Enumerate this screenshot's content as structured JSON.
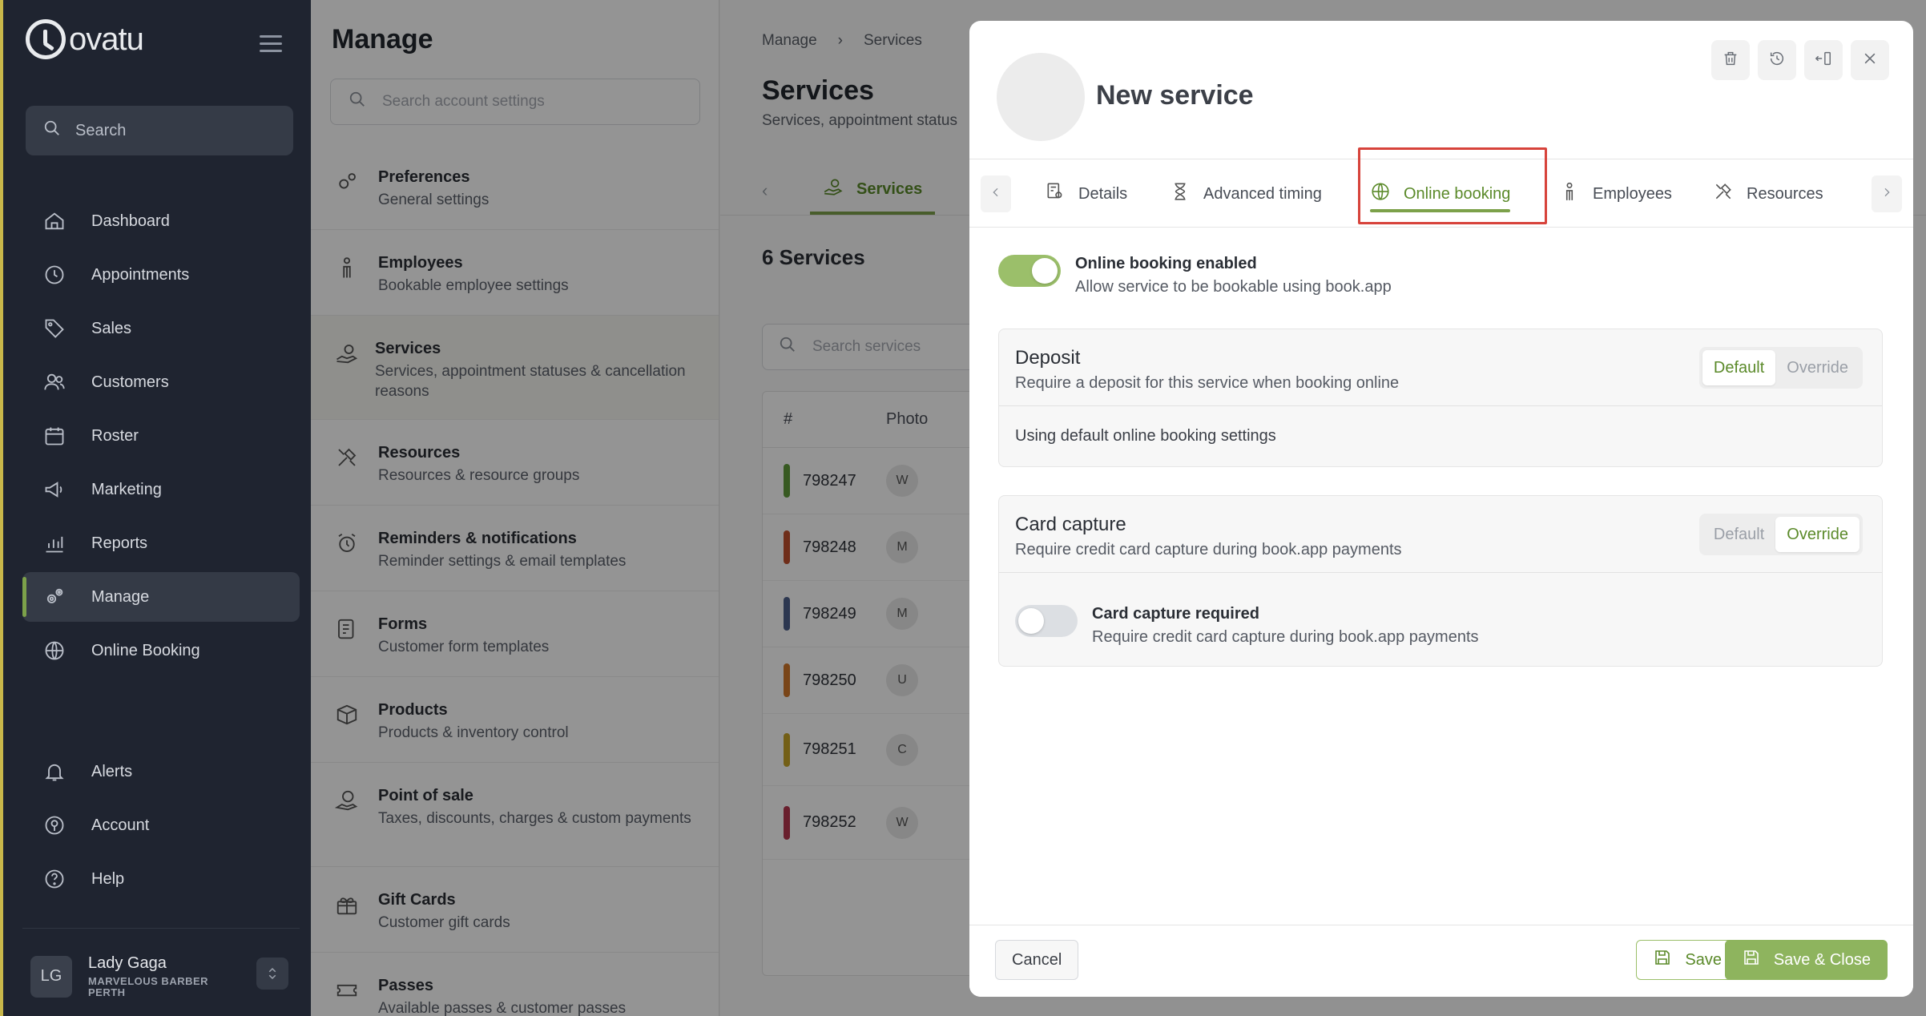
{
  "sidebar": {
    "brand": "ovatu",
    "search_placeholder": "Search",
    "nav": [
      {
        "label": "Dashboard",
        "icon": "home-icon"
      },
      {
        "label": "Appointments",
        "icon": "clock-icon"
      },
      {
        "label": "Sales",
        "icon": "tag-icon"
      },
      {
        "label": "Customers",
        "icon": "users-icon"
      },
      {
        "label": "Roster",
        "icon": "calendar-icon"
      },
      {
        "label": "Marketing",
        "icon": "megaphone-icon"
      },
      {
        "label": "Reports",
        "icon": "chart-icon"
      },
      {
        "label": "Manage",
        "icon": "gears-icon"
      },
      {
        "label": "Online Booking",
        "icon": "globe-icon"
      }
    ],
    "nav_bottom": [
      {
        "label": "Alerts",
        "icon": "bell-icon"
      },
      {
        "label": "Account",
        "icon": "account-icon"
      },
      {
        "label": "Help",
        "icon": "help-icon"
      }
    ],
    "user": {
      "initials": "LG",
      "name": "Lady Gaga",
      "org": "MARVELOUS BARBER PERTH"
    }
  },
  "manage": {
    "title": "Manage",
    "search_placeholder": "Search account settings",
    "items": [
      {
        "title": "Preferences",
        "sub": "General settings",
        "icon": "preferences-icon"
      },
      {
        "title": "Employees",
        "sub": "Bookable employee settings",
        "icon": "employee-icon"
      },
      {
        "title": "Services",
        "sub": "Services, appointment statuses & cancellation reasons",
        "icon": "services-icon"
      },
      {
        "title": "Resources",
        "sub": "Resources & resource groups",
        "icon": "resources-icon"
      },
      {
        "title": "Reminders & notifications",
        "sub": "Reminder settings & email templates",
        "icon": "alarm-icon"
      },
      {
        "title": "Forms",
        "sub": "Customer form templates",
        "icon": "form-icon"
      },
      {
        "title": "Products",
        "sub": "Products & inventory control",
        "icon": "box-icon"
      },
      {
        "title": "Point of sale",
        "sub": "Taxes, discounts, charges & custom payments",
        "icon": "pos-icon"
      },
      {
        "title": "Gift Cards",
        "sub": "Customer gift cards",
        "icon": "gift-icon"
      },
      {
        "title": "Passes",
        "sub": "Available passes & customer passes",
        "icon": "ticket-icon"
      }
    ]
  },
  "services": {
    "crumbs": [
      "Manage",
      "Services"
    ],
    "title": "Services",
    "subtitle": "Services, appointment status",
    "tab_label": "Services",
    "count": "6 Services",
    "search_placeholder": "Search services",
    "columns": [
      "#",
      "Photo"
    ],
    "rows": [
      {
        "id": "798247",
        "photo": "W",
        "color": "#5f9a3a"
      },
      {
        "id": "798248",
        "photo": "M",
        "color": "#c0502e"
      },
      {
        "id": "798249",
        "photo": "M",
        "color": "#4d5f8a"
      },
      {
        "id": "798250",
        "photo": "U",
        "color": "#d0782a"
      },
      {
        "id": "798251",
        "photo": "C",
        "color": "#c7a426"
      },
      {
        "id": "798252",
        "photo": "W",
        "color": "#b5364e"
      }
    ]
  },
  "modal": {
    "title": "New service",
    "tabs": [
      {
        "label": "Details",
        "icon": "details-icon"
      },
      {
        "label": "Advanced timing",
        "icon": "hourglass-icon"
      },
      {
        "label": "Online booking",
        "icon": "globe-icon"
      },
      {
        "label": "Employees",
        "icon": "employee-icon"
      },
      {
        "label": "Resources",
        "icon": "resources-icon"
      }
    ],
    "online_booking": {
      "title": "Online booking enabled",
      "sub": "Allow service to be bookable using book.app",
      "enabled": true
    },
    "deposit": {
      "title": "Deposit",
      "sub": "Require a deposit for this service when booking online",
      "default_label": "Default",
      "override_label": "Override",
      "selected": "Default",
      "body": "Using default online booking settings"
    },
    "card_capture": {
      "title": "Card capture",
      "sub": "Require credit card capture during book.app payments",
      "default_label": "Default",
      "override_label": "Override",
      "selected": "Override",
      "toggle_title": "Card capture required",
      "toggle_sub": "Require credit card capture during book.app payments",
      "required": false
    },
    "footer": {
      "cancel": "Cancel",
      "save": "Save",
      "save_close": "Save & Close"
    }
  },
  "colors": {
    "accent": "#7ca14a",
    "accent_dark": "#5b8a2a",
    "sidebar_bg": "#1f2430",
    "highlight": "#d7433b"
  }
}
